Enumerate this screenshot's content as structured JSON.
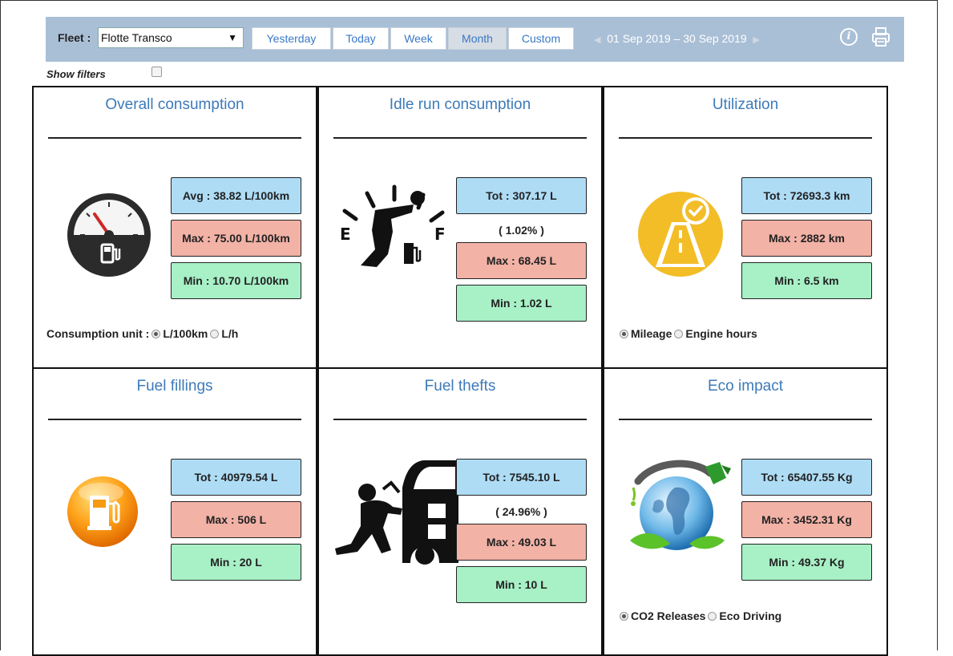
{
  "toolbar": {
    "fleet_label": "Fleet :",
    "fleet_value": "Flotte Transco",
    "periods": [
      "Yesterday",
      "Today",
      "Week",
      "Month",
      "Custom"
    ],
    "active_period": "Month",
    "date_from": "01 Sep 2019",
    "date_sep": "–",
    "date_to": "30 Sep 2019"
  },
  "filters": {
    "label": "Show filters",
    "checked": false
  },
  "cards": {
    "overall": {
      "title": "Overall consumption",
      "avg": "Avg : 38.82 L/100km",
      "max": "Max : 75.00 L/100km",
      "min": "Min : 10.70 L/100km",
      "unit_label": "Consumption unit :",
      "unit_options": [
        "L/100km",
        "L/h"
      ],
      "unit_selected": "L/100km"
    },
    "idle": {
      "title": "Idle run consumption",
      "tot": "Tot : 307.17 L",
      "pct": "( 1.02% )",
      "max": "Max : 68.45 L",
      "min": "Min : 1.02 L"
    },
    "utilization": {
      "title": "Utilization",
      "tot": "Tot : 72693.3 km",
      "max": "Max : 2882 km",
      "min": "Min : 6.5 km",
      "options": [
        "Mileage",
        "Engine hours"
      ],
      "selected": "Mileage"
    },
    "fillings": {
      "title": "Fuel fillings",
      "tot": "Tot : 40979.54 L",
      "max": "Max : 506 L",
      "min": "Min : 20 L"
    },
    "thefts": {
      "title": "Fuel thefts",
      "tot": "Tot : 7545.10 L",
      "pct": "( 24.96% )",
      "max": "Max : 49.03 L",
      "min": "Min : 10 L"
    },
    "eco": {
      "title": "Eco impact",
      "tot": "Tot : 65407.55 Kg",
      "max": "Max : 3452.31 Kg",
      "min": "Min : 49.37 Kg",
      "options": [
        "CO2 Releases",
        "Eco Driving"
      ],
      "selected": "CO2 Releases"
    }
  },
  "gauge_letters": {
    "empty": "E",
    "full": "F"
  },
  "colors": {
    "toolbar": "#a9bfd6",
    "title": "#3d7ab8",
    "tot": "#aedcf5",
    "max": "#f2b2a6",
    "min": "#a8f0c6"
  }
}
